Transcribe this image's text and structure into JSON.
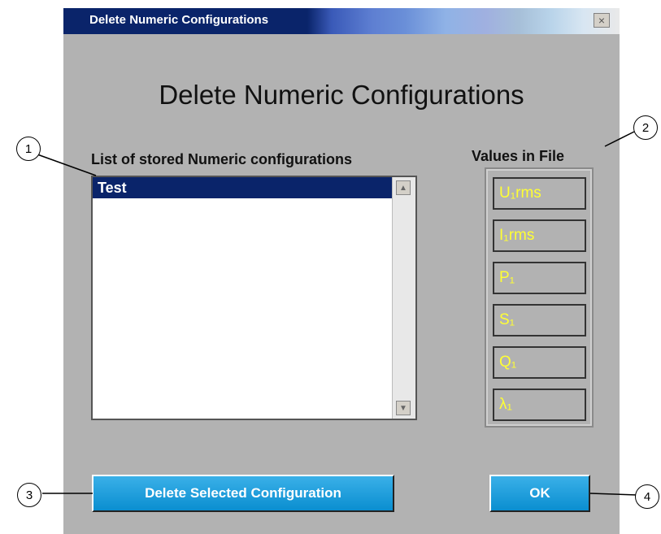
{
  "window": {
    "title": "Delete Numeric Configurations",
    "close_label": "×"
  },
  "heading": "Delete Numeric Configurations",
  "list": {
    "label": "List of stored Numeric configurations",
    "items": [
      "Test"
    ],
    "scroll_up": "▲",
    "scroll_down": "▼"
  },
  "values": {
    "label": "Values in File",
    "items": [
      "U₁rms",
      "I₁rms",
      "P₁",
      "S₁",
      "Q₁",
      "λ₁"
    ]
  },
  "buttons": {
    "delete": "Delete Selected Configuration",
    "ok": "OK"
  },
  "callouts": [
    "1",
    "2",
    "3",
    "4"
  ],
  "colors": {
    "selection": "#0a246a",
    "button": "#0a8ed0",
    "value_text": "#ffff33",
    "dialog_bg": "#b2b2b2"
  }
}
